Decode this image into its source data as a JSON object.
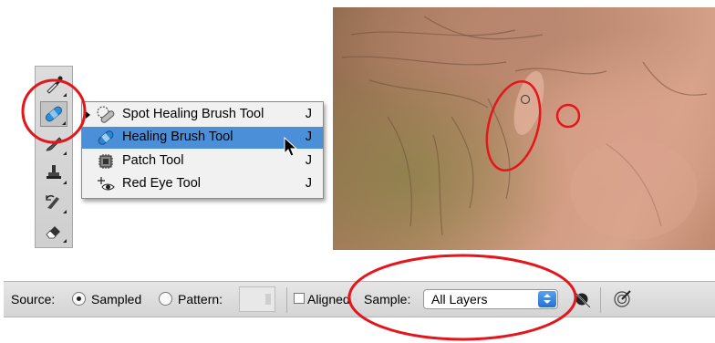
{
  "toolbox": {
    "tools": [
      {
        "name": "eyedropper-tool",
        "icon": "eyedropper-icon"
      },
      {
        "name": "healing-tool",
        "icon": "bandage-icon",
        "active": true
      },
      {
        "name": "brush-tool",
        "icon": "brush-icon"
      },
      {
        "name": "clone-stamp-tool",
        "icon": "stamp-icon"
      },
      {
        "name": "history-brush-tool",
        "icon": "history-brush-icon"
      },
      {
        "name": "eraser-tool",
        "icon": "eraser-icon"
      }
    ]
  },
  "flyout": {
    "items": [
      {
        "label": "Spot Healing Brush Tool",
        "shortcut": "J",
        "icon": "spot-healing-icon",
        "selected": false,
        "current": true
      },
      {
        "label": "Healing Brush Tool",
        "shortcut": "J",
        "icon": "healing-brush-icon",
        "selected": true
      },
      {
        "label": "Patch Tool",
        "shortcut": "J",
        "icon": "patch-icon",
        "selected": false
      },
      {
        "label": "Red Eye Tool",
        "shortcut": "J",
        "icon": "red-eye-icon",
        "selected": false
      }
    ]
  },
  "options": {
    "source_label": "Source:",
    "sampled_label": "Sampled",
    "sampled_checked": true,
    "pattern_label": "Pattern:",
    "pattern_checked": false,
    "aligned_label": "Aligned",
    "aligned_checked": false,
    "sample_label": "Sample:",
    "sample_value": "All Layers"
  },
  "colors": {
    "annotation": "#e4161b",
    "selection": "#4a8fd8"
  }
}
